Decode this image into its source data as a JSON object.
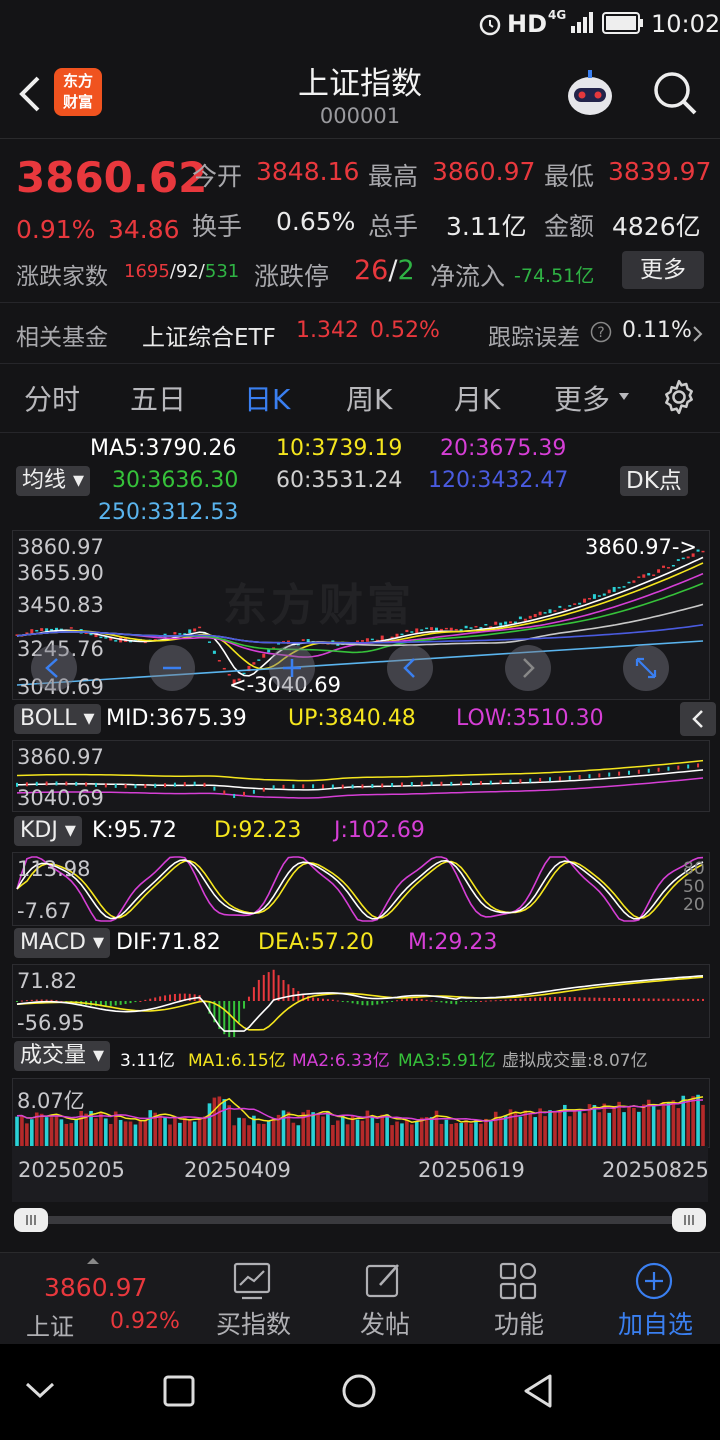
{
  "status_bar": {
    "network": "HD",
    "signal_gen": "4G",
    "time": "10:02"
  },
  "header": {
    "title": "上证指数",
    "code": "000001",
    "logo_line1": "东方",
    "logo_line2": "财富"
  },
  "quote": {
    "price": "3860.62",
    "change_pct": "0.91%",
    "change": "34.86",
    "open_label": "今开",
    "open": "3848.16",
    "high_label": "最高",
    "high": "3860.97",
    "low_label": "最低",
    "low": "3839.97",
    "turnover_label": "换手",
    "turnover": "0.65%",
    "volume_label": "总手",
    "volume": "3.11亿",
    "amount_label": "金额",
    "amount": "4826亿",
    "adv_label": "涨跌家数",
    "adv_up": "1695",
    "adv_flat": "92",
    "adv_down": "531",
    "limit_label": "涨跌停",
    "limit_up": "26",
    "limit_down": "2",
    "netflow_label": "净流入",
    "netflow": "-74.51亿",
    "more_label": "更多"
  },
  "fund": {
    "label": "相关基金",
    "name": "上证综合ETF",
    "price": "1.342",
    "pct": "0.52%",
    "track_label": "跟踪误差",
    "track_value": "0.11%"
  },
  "tabs": [
    "分时",
    "五日",
    "日K",
    "周K",
    "月K",
    "更多"
  ],
  "ma": {
    "chip": "均线",
    "dk": "DK点",
    "ma5": "MA5:3790.26",
    "ma10": "10:3739.19",
    "ma20": "20:3675.39",
    "ma30": "30:3636.30",
    "ma60": "60:3531.24",
    "ma120": "120:3432.47",
    "ma250": "250:3312.53"
  },
  "kline": {
    "y_high": "3860.97",
    "y_2": "3655.90",
    "y_3": "3450.83",
    "y_4": "3245.76",
    "y_low": "3040.69",
    "high_marker": "3860.97->",
    "low_marker": "<-3040.69",
    "watermark": "东方财富"
  },
  "boll": {
    "chip": "BOLL",
    "mid": "MID:3675.39",
    "up": "UP:3840.48",
    "low": "LOW:3510.30",
    "y_high": "3860.97",
    "y_low": "3040.69"
  },
  "kdj": {
    "chip": "KDJ",
    "k": "K:95.72",
    "d": "D:92.23",
    "j": "J:102.69",
    "y_high": "113.98",
    "y_low": "-7.67",
    "r80": "80",
    "r50": "50",
    "r20": "20"
  },
  "macd": {
    "chip": "MACD",
    "dif": "DIF:71.82",
    "dea": "DEA:57.20",
    "m": "M:29.23",
    "y_high": "71.82",
    "y_low": "-56.95"
  },
  "vol": {
    "chip": "成交量",
    "v": "3.11亿",
    "ma1": "MA1:6.15亿",
    "ma2": "MA2:6.33亿",
    "ma3": "MA3:5.91亿",
    "virtual": "虚拟成交量:8.07亿",
    "y_high": "8.07亿"
  },
  "dates": [
    "20250205",
    "20250409",
    "20250619",
    "20250825"
  ],
  "bottom": {
    "price": "3860.97",
    "name": "上证",
    "pct": "0.92%",
    "b1": "买指数",
    "b2": "发帖",
    "b3": "功能",
    "b4": "加自选"
  },
  "colors": {
    "up": "#e8383d",
    "down": "#2fb344",
    "accent": "#3a7ff0",
    "ma5": "#ffffff",
    "ma10": "#f5e61e",
    "ma20": "#d63fd6",
    "ma30": "#36c23a",
    "ma60": "#c8c8c8",
    "ma120": "#4a5be0",
    "ma250": "#5ab4ee"
  }
}
